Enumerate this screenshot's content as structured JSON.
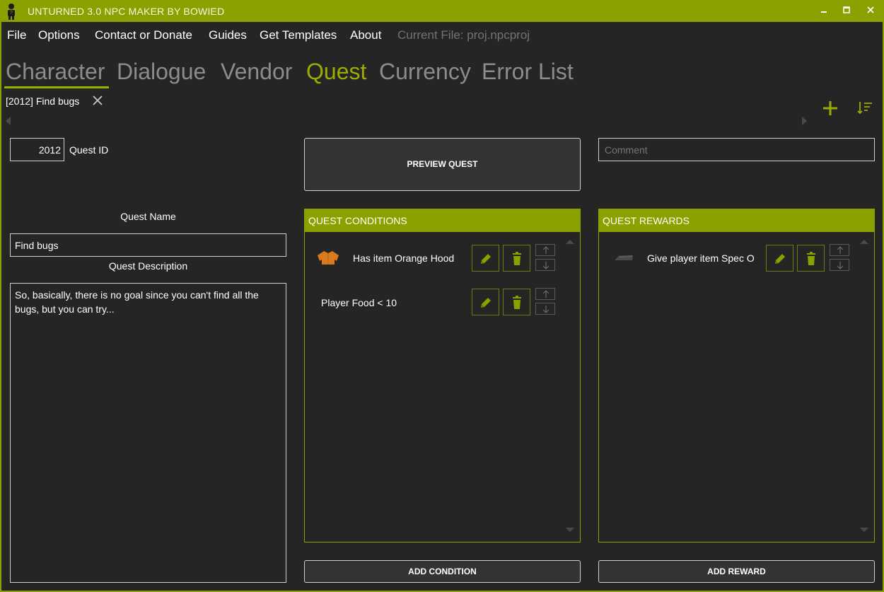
{
  "window": {
    "title": "UNTURNED 3.0 NPC MAKER BY BOWIED",
    "controls": [
      "minimize-icon",
      "maximize-icon",
      "close-icon"
    ]
  },
  "menu": {
    "items": [
      "File",
      "Options",
      "Contact or Donate",
      "Guides",
      "Get Templates",
      "About"
    ],
    "current_file": "Current File: proj.npcproj"
  },
  "tabs": [
    {
      "label": "Character",
      "active": false
    },
    {
      "label": "Dialogue",
      "active": false
    },
    {
      "label": "Vendor",
      "active": false
    },
    {
      "label": "Quest",
      "active": true
    },
    {
      "label": "Currency",
      "active": false
    },
    {
      "label": "Error List",
      "active": false
    }
  ],
  "document_tab": {
    "label": "[2012] Find bugs"
  },
  "toolbar": {
    "add_icon": "plus-icon",
    "sort_icon": "sort-icon"
  },
  "quest": {
    "id_value": "2012",
    "id_label": "Quest ID",
    "preview_label": "PREVIEW QUEST",
    "comment_placeholder": "Comment",
    "name_label": "Quest Name",
    "name_value": "Find bugs",
    "description_label": "Quest Description",
    "description_value": "So, basically, there is no goal since you can't find all the bugs, but you can try..."
  },
  "conditions": {
    "header": "QUEST CONDITIONS",
    "items": [
      {
        "text": "Has item Orange Hood",
        "icon": "orange-hoodie-icon"
      },
      {
        "text": "Player Food < 10",
        "icon": ""
      }
    ],
    "add_label": "ADD CONDITION"
  },
  "rewards": {
    "header": "QUEST REWARDS",
    "items": [
      {
        "text": "Give player item Spec O",
        "icon": "spec-ops-item-icon"
      }
    ],
    "add_label": "ADD REWARD"
  },
  "colors": {
    "accent": "#8aa100",
    "accent_text": "#9aad00",
    "background": "#252526",
    "muted_text": "#737373",
    "item_icon_orange": "#d97a1c"
  }
}
